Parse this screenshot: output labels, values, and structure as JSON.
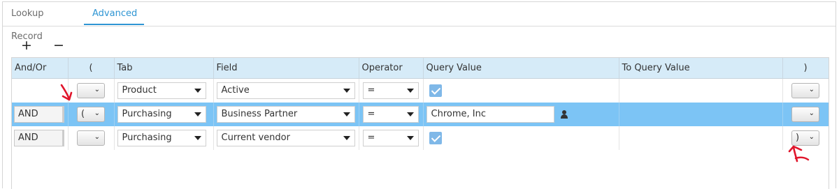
{
  "tabs": [
    {
      "label": "Lookup Record",
      "active": false
    },
    {
      "label": "Advanced",
      "active": true
    }
  ],
  "toolbar": {
    "add_label": "+",
    "remove_label": "−"
  },
  "columns": [
    "And/Or",
    "(",
    "Tab",
    "Field",
    "Operator",
    "Query Value",
    "To Query Value",
    ")"
  ],
  "rows": [
    {
      "andor": "",
      "open_paren": "",
      "tab": "Product",
      "field": "Active",
      "operator": "=",
      "query_value": "",
      "query_checked": true,
      "close_paren": "",
      "selected": false
    },
    {
      "andor": "AND",
      "open_paren": "(",
      "tab": "Purchasing",
      "field": "Business Partner",
      "operator": "=",
      "query_value": "Chrome, Inc",
      "query_checked": false,
      "close_paren": "",
      "selected": true
    },
    {
      "andor": "AND",
      "open_paren": "",
      "tab": "Purchasing",
      "field": "Current vendor",
      "operator": "=",
      "query_value": "",
      "query_checked": true,
      "close_paren": ")",
      "selected": false
    }
  ],
  "colors": {
    "accent": "#2e95d3",
    "header_bg": "#d6ebf8",
    "selected_row": "#7cc4f5",
    "annotation": "#e0152b"
  },
  "icons": {
    "lookup": "person-icon",
    "dropdown": "chevron-down-icon",
    "checkbox": "checkmark-icon"
  }
}
